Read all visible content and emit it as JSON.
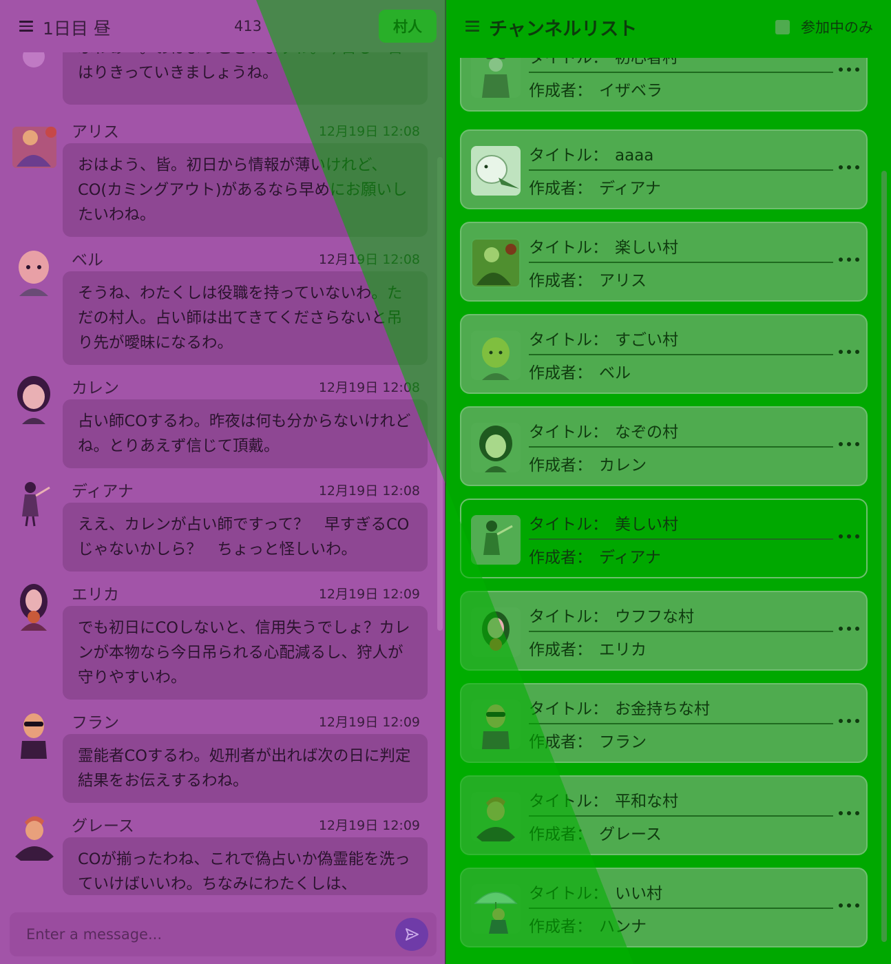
{
  "chat": {
    "header": {
      "day_title": "1日目 昼",
      "counter": "413",
      "role_label": "村人"
    },
    "messages": [
      {
        "sender": "",
        "time": "",
        "text": "ふわぁー。おはようございますわ。今日も一日はりきっていきましょうね。"
      },
      {
        "sender": "アリス",
        "time": "12月19日 12:08",
        "text": "おはよう、皆。初日から情報が薄いけれど、CO(カミングアウト)があるなら早めにお願いしたいわね。"
      },
      {
        "sender": "ベル",
        "time": "12月19日 12:08",
        "text": "そうね、わたくしは役職を持っていないわ。ただの村人。占い師は出てきてくださらないと吊り先が曖昧になるわ。"
      },
      {
        "sender": "カレン",
        "time": "12月19日 12:08",
        "text": "占い師COするわ。昨夜は何も分からないけれどね。とりあえず信じて頂戴。"
      },
      {
        "sender": "ディアナ",
        "time": "12月19日 12:08",
        "text": "ええ、カレンが占い師ですって？　早すぎるCOじゃないかしら？　ちょっと怪しいわ。"
      },
      {
        "sender": "エリカ",
        "time": "12月19日 12:09",
        "text": "でも初日にCOしないと、信用失うでしょ？カレンが本物なら今日吊られる心配減るし、狩人が守りやすいわ。"
      },
      {
        "sender": "フラン",
        "time": "12月19日 12:09",
        "text": "霊能者COするわ。処刑者が出れば次の日に判定結果をお伝えするわね。"
      },
      {
        "sender": "グレース",
        "time": "12月19日 12:09",
        "text": "COが揃ったわね、これで偽占いか偽霊能を洗っていけばいいわ。ちなみにわたくしは、"
      }
    ],
    "composer": {
      "placeholder": "Enter a message..."
    }
  },
  "channels": {
    "header": {
      "title": "チャンネルリスト",
      "filter_label": "参加中のみ"
    },
    "title_prefix": "タイトル：",
    "author_prefix": "作成者：",
    "cards": [
      {
        "title": "初心者村",
        "author": "イザベラ",
        "icon": "soldier-avatar-icon"
      },
      {
        "title": "aaaa",
        "author": "ディアナ",
        "icon": "bird-avatar-icon"
      },
      {
        "title": "楽しい村",
        "author": "アリス",
        "icon": "alice-avatar-icon"
      },
      {
        "title": "すごい村",
        "author": "ベル",
        "icon": "bald-man-avatar-icon"
      },
      {
        "title": "なぞの村",
        "author": "カレン",
        "icon": "girl-avatar-icon"
      },
      {
        "title": "美しい村",
        "author": "ディアナ",
        "icon": "dancer-avatar-icon"
      },
      {
        "title": "ウフフな村",
        "author": "エリカ",
        "icon": "woman-avatar-icon"
      },
      {
        "title": "お金持ちな村",
        "author": "フラン",
        "icon": "sunglasses-avatar-icon"
      },
      {
        "title": "平和な村",
        "author": "グレース",
        "icon": "punk-avatar-icon"
      },
      {
        "title": "いい村",
        "author": "ハンナ",
        "icon": "umbrella-avatar-icon"
      }
    ]
  },
  "colors": {
    "chat_bg": "#a254a8",
    "bubble_bg": "#8e4793",
    "channel_bg": "#00a800",
    "card_bg": "#4fab4f",
    "send_button": "#6f3ba8"
  }
}
